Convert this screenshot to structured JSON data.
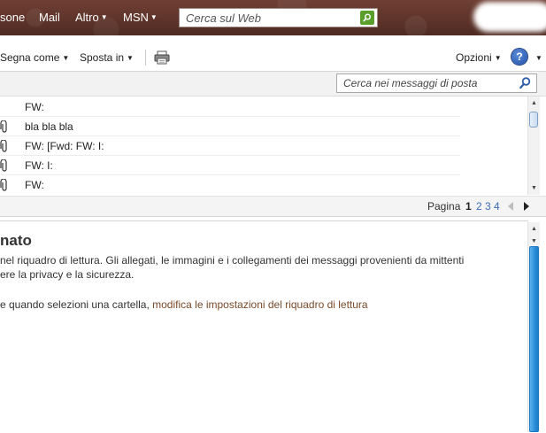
{
  "top_nav": {
    "people_label": "sone",
    "mail_label": "Mail",
    "other_label": "Altro",
    "msn_label": "MSN",
    "web_search_placeholder": "Cerca sul Web"
  },
  "toolbar": {
    "mark_as_label": "Segna come",
    "move_to_label": "Sposta in",
    "options_label": "Opzioni"
  },
  "mail_search": {
    "placeholder": "Cerca nei messaggi di posta"
  },
  "messages": [
    {
      "subject": "FW:",
      "has_attachment": false
    },
    {
      "subject": "bla bla bla",
      "has_attachment": true
    },
    {
      "subject": "FW: [Fwd: FW: I:",
      "has_attachment": true
    },
    {
      "subject": "FW: I:",
      "has_attachment": true
    },
    {
      "subject": "FW:",
      "has_attachment": true
    }
  ],
  "pager": {
    "label": "Pagina",
    "current": "1",
    "pages": [
      "2",
      "3",
      "4"
    ]
  },
  "reading_pane": {
    "title": "nato",
    "line1": "nel riquadro di lettura. Gli allegati, le immagini e i collegamenti dei messaggi provenienti da mittenti",
    "line2": "ere la privacy e la sicurezza.",
    "line3_prefix": "e quando selezioni una cartella,",
    "line3_link": "modifica le impostazioni del riquadro di lettura"
  },
  "colors": {
    "header_brown": "#5d3329",
    "search_green": "#5a9e2b",
    "link_blue": "#3b6db3",
    "link_brown": "#7a4a2a",
    "scroll_blue": "#2a8fd8"
  }
}
